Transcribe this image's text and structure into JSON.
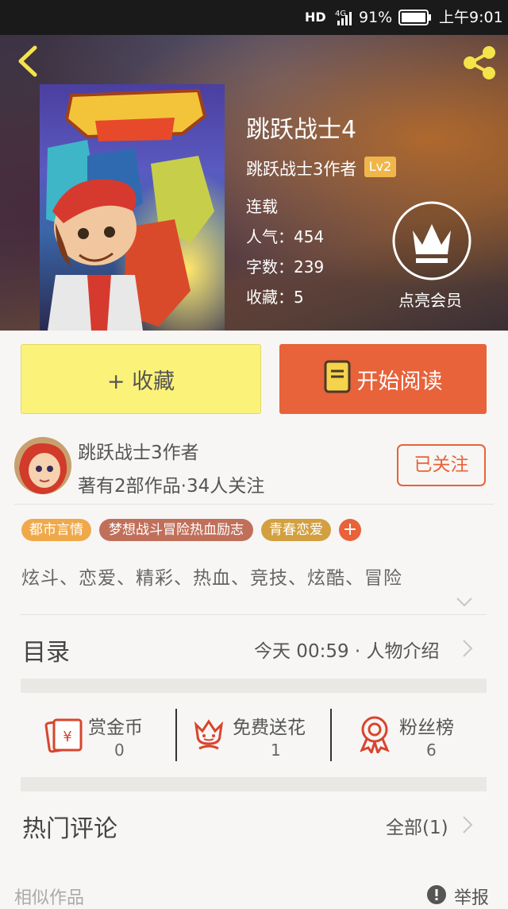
{
  "status_bar": {
    "hd": "HD",
    "network": "4G",
    "battery": "91%",
    "time": "上午9:01"
  },
  "book": {
    "title": "跳跃战士4",
    "author": "跳跃战士3作者",
    "level": "Lv2",
    "status": "连载",
    "popularity_label": "人气：",
    "popularity": "454",
    "words_label": "字数：",
    "words": "239",
    "favorites_label": "收藏：",
    "favorites": "5",
    "vip_label": "点亮会员"
  },
  "actions": {
    "collect": "+ 收藏",
    "read": "开始阅读"
  },
  "author_card": {
    "name": "跳跃战士3作者",
    "stats": "著有2部作品·34人关注",
    "follow_button": "已关注"
  },
  "tags": [
    {
      "label": "都市言情",
      "color": "#f0a94a"
    },
    {
      "label": "梦想战斗冒险热血励志",
      "color": "#c0705a"
    },
    {
      "label": "青春恋爱",
      "color": "#d2a040"
    }
  ],
  "tag_add": "+",
  "keywords": "炫斗、恋爱、精彩、热血、竞技、炫酷、冒险",
  "catalog": {
    "label": "目录",
    "latest": "今天 00:59 · 人物介绍"
  },
  "stats": [
    {
      "label": "赏金币",
      "value": "0",
      "icon": "red-envelope-icon"
    },
    {
      "label": "免费送花",
      "value": "1",
      "icon": "flower-icon"
    },
    {
      "label": "粉丝榜",
      "value": "6",
      "icon": "medal-icon"
    }
  ],
  "comments": {
    "label": "热门评论",
    "all": "全部(1)"
  },
  "similar": {
    "label": "相似作品",
    "report": "举报"
  },
  "colors": {
    "accent": "#e8623a",
    "collect_bg": "#fbf27a",
    "stat_icon": "#d8452e"
  }
}
